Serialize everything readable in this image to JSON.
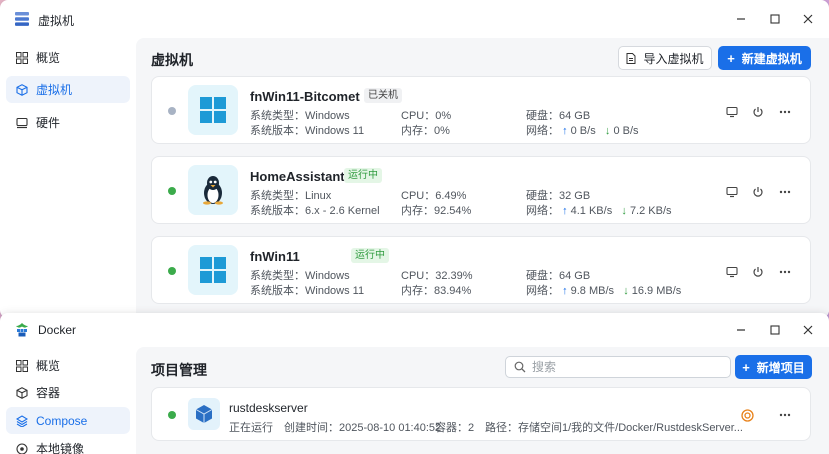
{
  "vm_window": {
    "title": "虚拟机",
    "sidebar": [
      {
        "label": "概览",
        "icon": "grid-icon",
        "active": false
      },
      {
        "label": "虚拟机",
        "icon": "cube-icon",
        "active": true
      },
      {
        "label": "硬件",
        "icon": "hardware-icon",
        "active": false
      }
    ],
    "page_title": "虚拟机",
    "import_label": "导入虚拟机",
    "new_label": "新建虚拟机",
    "vms": [
      {
        "name": "fnWin11-Bitcomet",
        "status": "已关机",
        "state": "stopped",
        "os": "windows",
        "type_label": "系统类型：Windows",
        "version_label": "系统版本：Windows 11",
        "cpu": "CPU：0%",
        "mem": "内存：0%",
        "disk": "硬盘：64 GB",
        "net_label": "网络：",
        "up": "0 B/s",
        "down": "0 B/s"
      },
      {
        "name": "HomeAssistant",
        "status": "运行中",
        "state": "running",
        "os": "linux",
        "type_label": "系统类型：Linux",
        "version_label": "系统版本：6.x - 2.6 Kernel",
        "cpu": "CPU：6.49%",
        "mem": "内存：92.54%",
        "disk": "硬盘：32 GB",
        "net_label": "网络：",
        "up": "4.1 KB/s",
        "down": "7.2 KB/s"
      },
      {
        "name": "fnWin11",
        "status": "运行中",
        "state": "running",
        "os": "windows",
        "type_label": "系统类型：Windows",
        "version_label": "系统版本：Windows 11",
        "cpu": "CPU：32.39%",
        "mem": "内存：83.94%",
        "disk": "硬盘：64 GB",
        "net_label": "网络：",
        "up": "9.8 MB/s",
        "down": "16.9 MB/s"
      }
    ]
  },
  "docker_window": {
    "title": "Docker",
    "sidebar": [
      {
        "label": "概览",
        "icon": "grid-icon",
        "active": false
      },
      {
        "label": "容器",
        "icon": "container-icon",
        "active": false
      },
      {
        "label": "Compose",
        "icon": "compose-icon",
        "active": true
      },
      {
        "label": "本地镜像",
        "icon": "image-icon",
        "active": false
      }
    ],
    "page_title": "项目管理",
    "search_placeholder": "搜索",
    "new_label": "新增项目",
    "project": {
      "name": "rustdeskserver",
      "status": "正在运行",
      "created": "创建时间：2025-08-10 01:40:52",
      "containers": "容器：2",
      "path": "路径：存储空间1/我的文件/Docker/RustdeskServer..."
    }
  },
  "colors": {
    "accent": "#1a6fe8",
    "running": "#3bab4b",
    "stopped": "#a8b3c4"
  }
}
